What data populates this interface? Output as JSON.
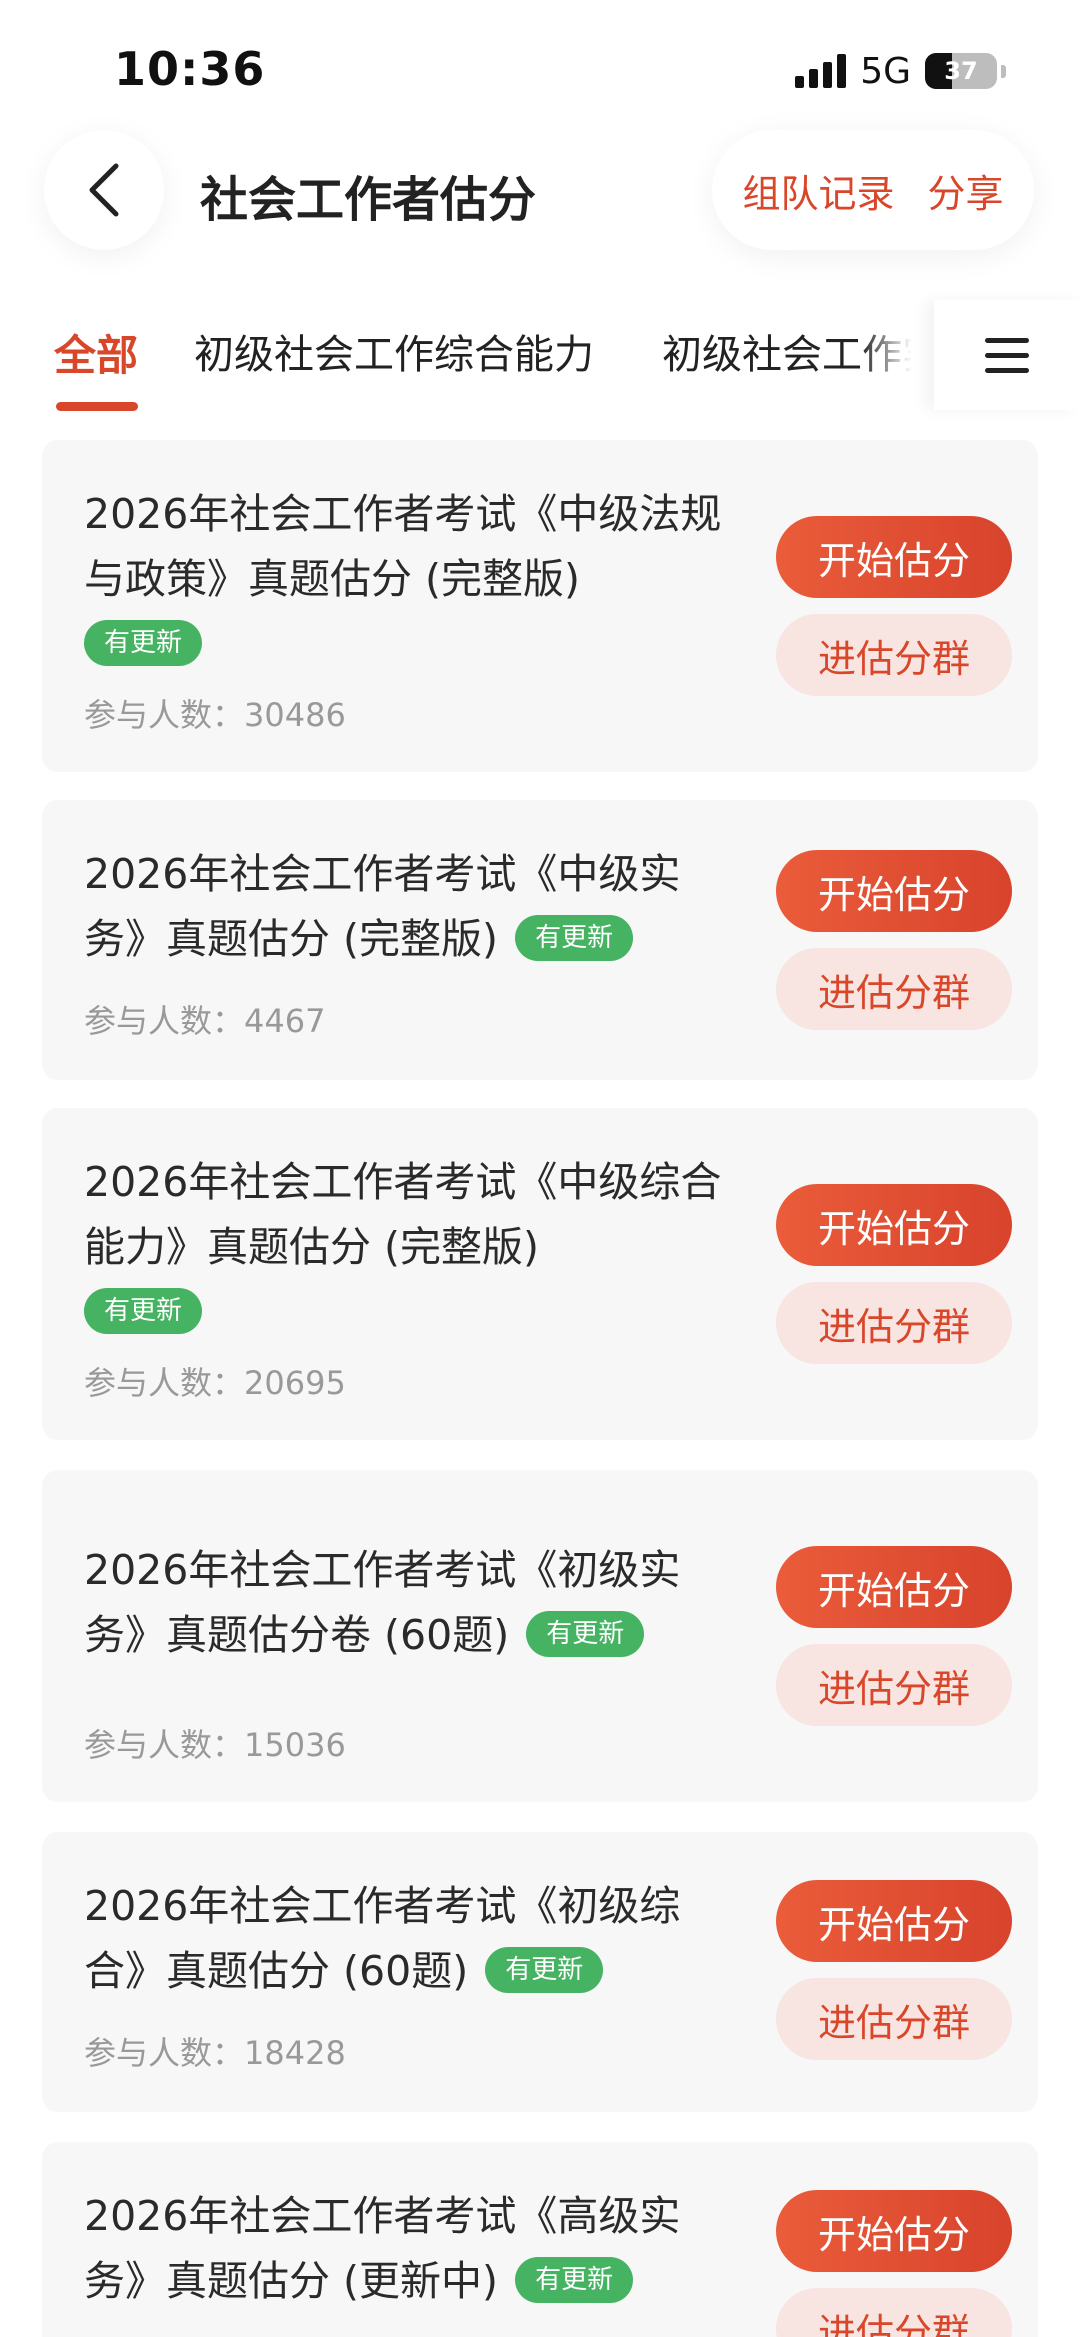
{
  "status_bar": {
    "time": "10:36",
    "network": "5G",
    "battery": "37",
    "battery_level": 0.37
  },
  "header": {
    "title": "社会工作者估分",
    "team_record": "组队记录",
    "share": "分享"
  },
  "tabs": [
    {
      "label": "全部",
      "active": true
    },
    {
      "label": "初级社会工作综合能力",
      "active": false
    },
    {
      "label": "初级社会工作实",
      "active": false
    }
  ],
  "badge_text": "有更新",
  "count_label": "参与人数：",
  "buttons": {
    "start": "开始估分",
    "join": "进估分群"
  },
  "cards": [
    {
      "title": "2026年社会工作者考试《中级法规与政策》真题估分 (完整版)",
      "count": "30486"
    },
    {
      "title": "2026年社会工作者考试《中级实务》真题估分 (完整版)",
      "count": "4467"
    },
    {
      "title": "2026年社会工作者考试《中级综合能力》真题估分 (完整版)",
      "count": "20695"
    },
    {
      "title": "2026年社会工作者考试《初级实务》真题估分卷 (60题)",
      "count": "15036"
    },
    {
      "title": "2026年社会工作者考试《初级综合》真题估分 (60题)",
      "count": "18428"
    },
    {
      "title": "2026年社会工作者考试《高级实务》真题估分 (更新中)",
      "count": ""
    }
  ],
  "colors": {
    "accent": "#d9472b",
    "badge": "#45b362",
    "card_bg": "#f7f7f7"
  }
}
